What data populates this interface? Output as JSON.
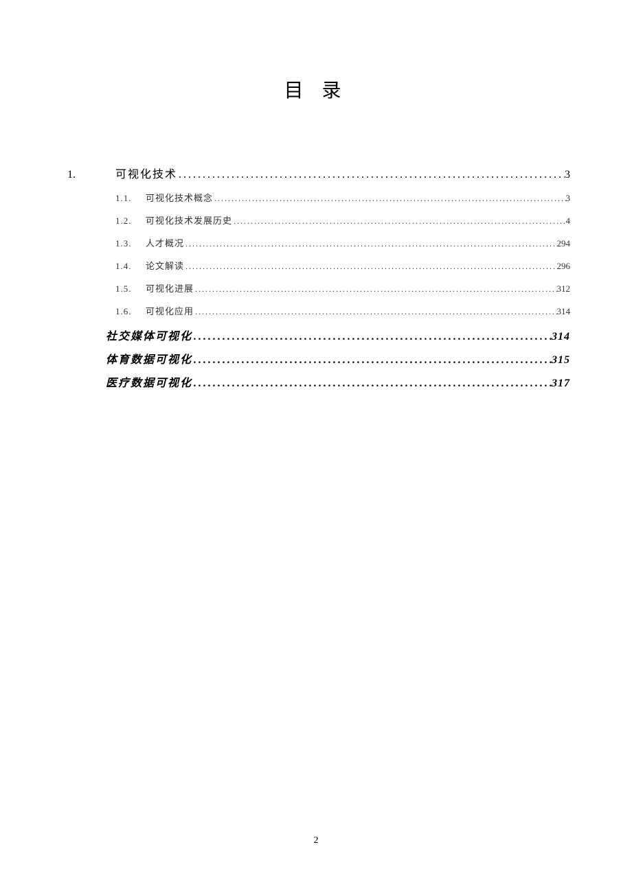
{
  "title": "目 录",
  "chapter": {
    "num": "1.",
    "label": "可视化技术",
    "page": "3"
  },
  "sections": [
    {
      "num": "1.1.",
      "label": "可视化技术概念",
      "page": "3"
    },
    {
      "num": "1.2.",
      "label": "可视化技术发展历史",
      "page": "4"
    },
    {
      "num": "1.3.",
      "label": "人才概况",
      "page": "294"
    },
    {
      "num": "1.4.",
      "label": "论文解读",
      "page": "296"
    },
    {
      "num": "1.5.",
      "label": "可视化进展",
      "page": "312"
    },
    {
      "num": "1.6.",
      "label": "可视化应用",
      "page": "314"
    }
  ],
  "subsections": [
    {
      "label": "社交媒体可视化",
      "page": "314"
    },
    {
      "label": "体育数据可视化",
      "page": "315"
    },
    {
      "label": "医疗数据可视化",
      "page": "317"
    }
  ],
  "leader_dots": "................................................................................................................................................................................",
  "page_number": "2"
}
